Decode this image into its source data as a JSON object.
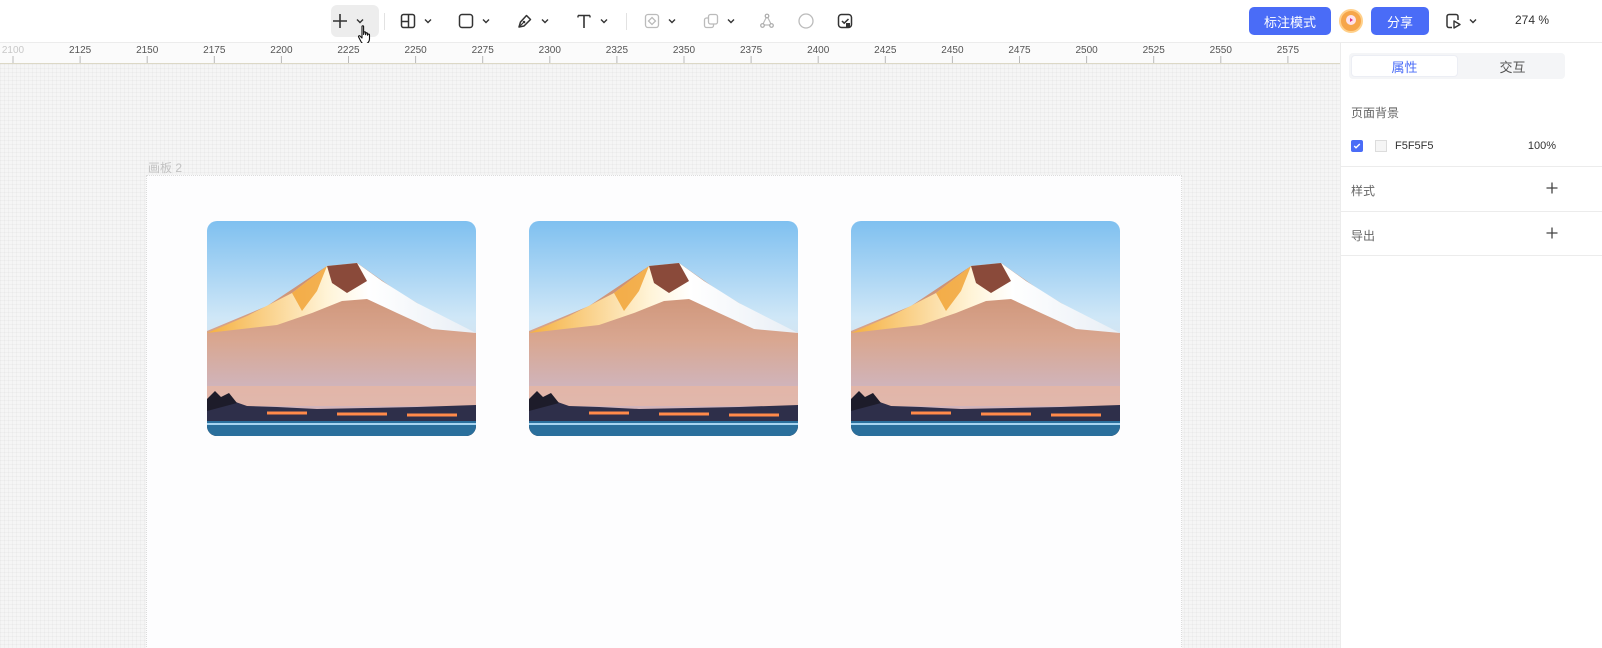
{
  "toolbar": {
    "tools": [
      {
        "name": "add",
        "icon": "plus-icon"
      },
      {
        "name": "frame",
        "icon": "frame-icon"
      },
      {
        "name": "rectangle",
        "icon": "rectangle-icon"
      },
      {
        "name": "pen",
        "icon": "pen-icon"
      },
      {
        "name": "text",
        "icon": "text-icon"
      },
      {
        "name": "component",
        "icon": "component-icon"
      },
      {
        "name": "boolean",
        "icon": "boolean-icon"
      },
      {
        "name": "nodes",
        "icon": "nodes-icon"
      },
      {
        "name": "mask",
        "icon": "circle-icon"
      },
      {
        "name": "check",
        "icon": "check-image-icon"
      }
    ],
    "annotate_mode_label": "标注模式",
    "share_label": "分享",
    "zoom_level": "274 %"
  },
  "ruler": {
    "ticks": [
      "2100",
      "2125",
      "2150",
      "2175",
      "2200",
      "2225",
      "2250",
      "2275",
      "2300",
      "2325",
      "2350",
      "2375",
      "2400",
      "2425",
      "2450",
      "2475",
      "2500",
      "2525",
      "2550",
      "2575"
    ]
  },
  "canvas": {
    "artboard_label": "画板 2",
    "image_count": 3
  },
  "panel": {
    "tabs": [
      {
        "label": "属性",
        "active": true
      },
      {
        "label": "交互",
        "active": false
      }
    ],
    "page_background_title": "页面背景",
    "background": {
      "checked": true,
      "hex": "F5F5F5",
      "opacity": "100%"
    },
    "style_title": "样式",
    "export_title": "导出"
  },
  "colors": {
    "accent": "#4a6cf7",
    "canvas_bg": "#F5F5F5",
    "avatar": "#f6a64a"
  }
}
